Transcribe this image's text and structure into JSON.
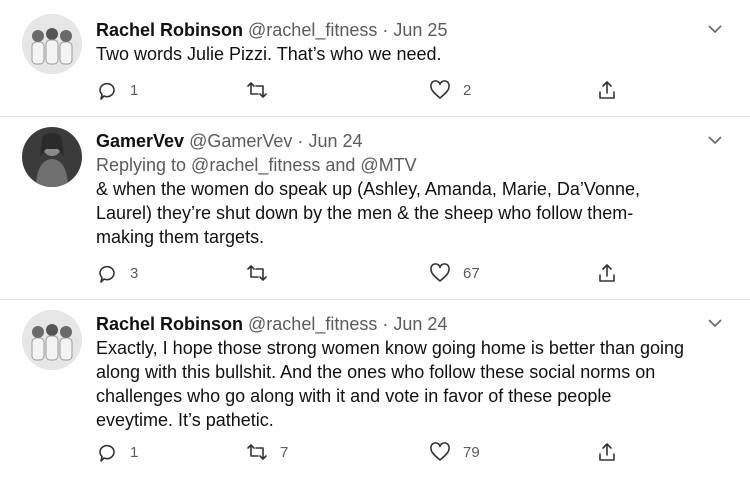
{
  "tweets": [
    {
      "name": "Rachel Robinson",
      "handle": "@rachel_fitness",
      "separator": "·",
      "date": "Jun 25",
      "reply_to": "",
      "text_lines": [
        "Two words Julie Pizzi. That’s who we need."
      ],
      "replies": "1",
      "retweets": "",
      "likes": "2"
    },
    {
      "name": "GamerVev",
      "handle": "@GamerVev",
      "separator": "·",
      "date": "Jun 24",
      "reply_to": "Replying to @rachel_fitness and @MTV",
      "text_lines": [
        "& when the women do speak up (Ashley, Amanda, Marie, Da’Vonne,",
        "Laurel) they’re shut down by the men & the sheep who follow them-",
        "making them targets."
      ],
      "replies": "3",
      "retweets": "",
      "likes": "67"
    },
    {
      "name": "Rachel Robinson",
      "handle": "@rachel_fitness",
      "separator": "·",
      "date": "Jun 24",
      "reply_to": "",
      "text_lines": [
        "Exactly, I hope those strong women know going home is better than going",
        "along with this bullshit. And the ones who follow these social norms on",
        "challenges who go along with it and vote in favor of these people",
        "eveytime. It’s pathetic."
      ],
      "replies": "1",
      "retweets": "7",
      "likes": "79"
    }
  ],
  "icons": {
    "reply": "speech-bubble-icon",
    "retweet": "retweet-icon",
    "like": "heart-icon",
    "share": "share-icon",
    "more": "chevron-down-icon"
  }
}
